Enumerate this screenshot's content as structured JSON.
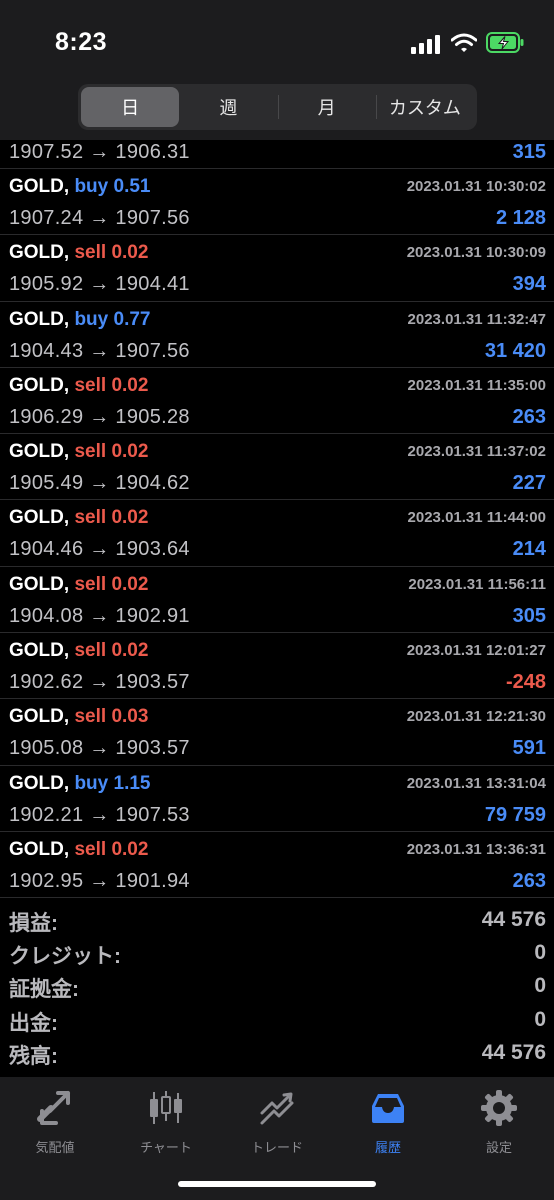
{
  "status": {
    "time": "8:23"
  },
  "periods": [
    "日",
    "週",
    "月",
    "カスタム"
  ],
  "partial_row": {
    "from": "1907.52",
    "to": "1906.31",
    "profit": "315"
  },
  "trades": [
    {
      "symbol": "GOLD,",
      "side": "buy",
      "lots": "0.51",
      "datetime": "2023.01.31 10:30:02",
      "from": "1907.24",
      "to": "1907.56",
      "profit": "2 128",
      "negative": false
    },
    {
      "symbol": "GOLD,",
      "side": "sell",
      "lots": "0.02",
      "datetime": "2023.01.31 10:30:09",
      "from": "1905.92",
      "to": "1904.41",
      "profit": "394",
      "negative": false
    },
    {
      "symbol": "GOLD,",
      "side": "buy",
      "lots": "0.77",
      "datetime": "2023.01.31 11:32:47",
      "from": "1904.43",
      "to": "1907.56",
      "profit": "31 420",
      "negative": false
    },
    {
      "symbol": "GOLD,",
      "side": "sell",
      "lots": "0.02",
      "datetime": "2023.01.31 11:35:00",
      "from": "1906.29",
      "to": "1905.28",
      "profit": "263",
      "negative": false
    },
    {
      "symbol": "GOLD,",
      "side": "sell",
      "lots": "0.02",
      "datetime": "2023.01.31 11:37:02",
      "from": "1905.49",
      "to": "1904.62",
      "profit": "227",
      "negative": false
    },
    {
      "symbol": "GOLD,",
      "side": "sell",
      "lots": "0.02",
      "datetime": "2023.01.31 11:44:00",
      "from": "1904.46",
      "to": "1903.64",
      "profit": "214",
      "negative": false
    },
    {
      "symbol": "GOLD,",
      "side": "sell",
      "lots": "0.02",
      "datetime": "2023.01.31 11:56:11",
      "from": "1904.08",
      "to": "1902.91",
      "profit": "305",
      "negative": false
    },
    {
      "symbol": "GOLD,",
      "side": "sell",
      "lots": "0.02",
      "datetime": "2023.01.31 12:01:27",
      "from": "1902.62",
      "to": "1903.57",
      "profit": "-248",
      "negative": true
    },
    {
      "symbol": "GOLD,",
      "side": "sell",
      "lots": "0.03",
      "datetime": "2023.01.31 12:21:30",
      "from": "1905.08",
      "to": "1903.57",
      "profit": "591",
      "negative": false
    },
    {
      "symbol": "GOLD,",
      "side": "buy",
      "lots": "1.15",
      "datetime": "2023.01.31 13:31:04",
      "from": "1902.21",
      "to": "1907.53",
      "profit": "79 759",
      "negative": false
    },
    {
      "symbol": "GOLD,",
      "side": "sell",
      "lots": "0.02",
      "datetime": "2023.01.31 13:36:31",
      "from": "1902.95",
      "to": "1901.94",
      "profit": "263",
      "negative": false
    }
  ],
  "summary": [
    {
      "label": "損益:",
      "value": "44 576"
    },
    {
      "label": "クレジット:",
      "value": "0"
    },
    {
      "label": "証拠金:",
      "value": "0"
    },
    {
      "label": "出金:",
      "value": "0"
    },
    {
      "label": "残高:",
      "value": "44 576"
    }
  ],
  "tabs": [
    {
      "label": "気配値",
      "icon": "quotes-icon",
      "active": false
    },
    {
      "label": "チャート",
      "icon": "chart-icon",
      "active": false
    },
    {
      "label": "トレード",
      "icon": "trade-icon",
      "active": false
    },
    {
      "label": "履歴",
      "icon": "history-icon",
      "active": true
    },
    {
      "label": "設定",
      "icon": "settings-icon",
      "active": false
    }
  ],
  "colors": {
    "buy": "#4a8cf7",
    "sell": "#ec5a4c",
    "active_tab": "#3d82f5",
    "inactive_tab": "#8e8e93"
  }
}
